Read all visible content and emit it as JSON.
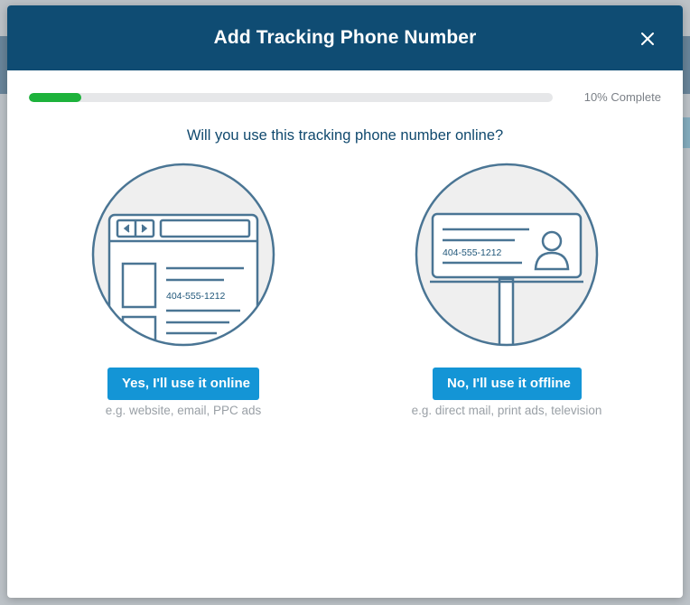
{
  "modal": {
    "title": "Add Tracking Phone Number",
    "close_icon": "close-icon"
  },
  "progress": {
    "percent": 10,
    "label": "10% Complete",
    "color": "#1db23b"
  },
  "question": "Will you use this tracking phone number online?",
  "options": {
    "online": {
      "button_label": "Yes, I'll use it online",
      "hint": "e.g. website, email, PPC ads",
      "phone": "404-555-1212",
      "icon": "browser-window-icon"
    },
    "offline": {
      "button_label": "No, I'll use it offline",
      "hint": "e.g. direct mail, print ads, television",
      "phone": "404-555-1212",
      "icon": "billboard-icon"
    }
  },
  "colors": {
    "header": "#0f4c73",
    "button": "#1495d6",
    "question_text": "#10496e",
    "illustration_stroke": "#4a7594"
  }
}
